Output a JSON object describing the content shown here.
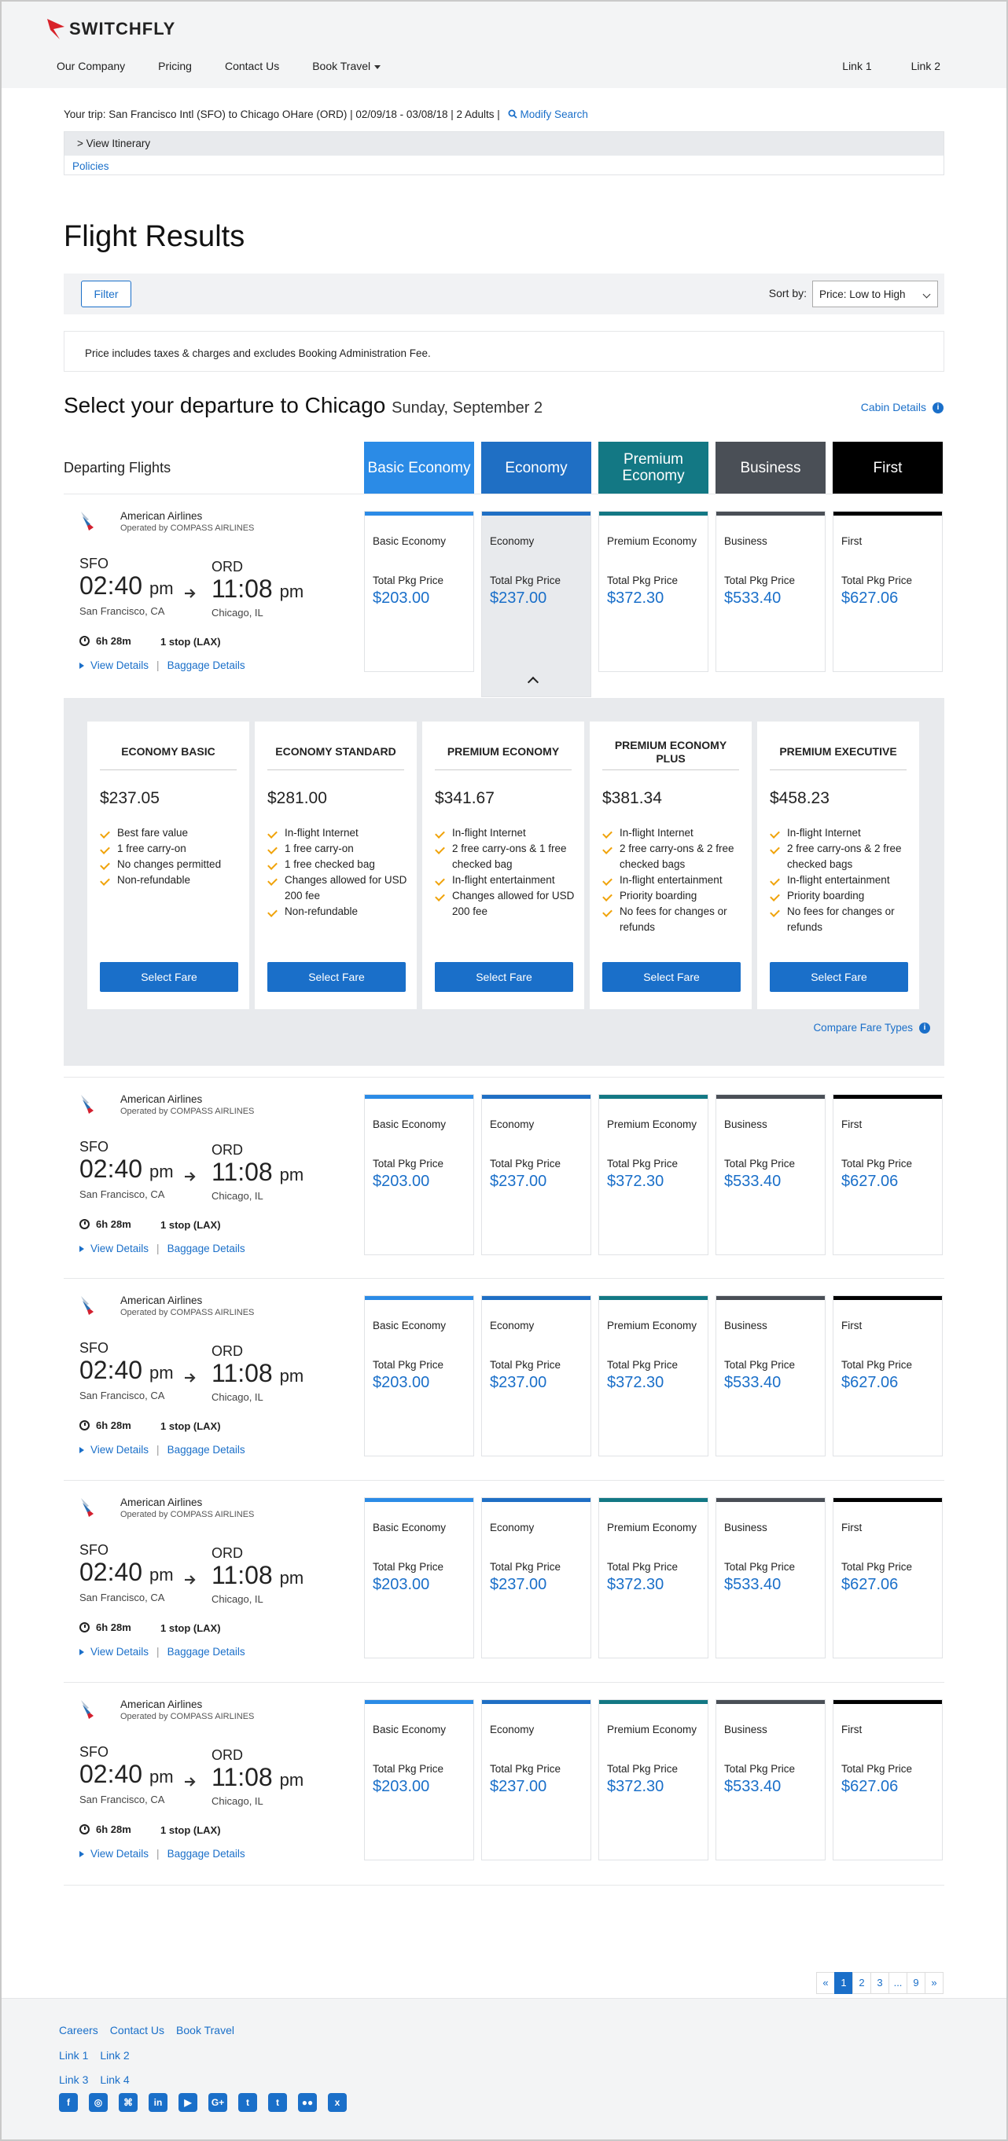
{
  "header": {
    "logo": "SWITCHFLY",
    "nav": [
      "Our Company",
      "Pricing",
      "Contact Us",
      "Book Travel"
    ],
    "nav_right": [
      "Link 1",
      "Link 2"
    ]
  },
  "trip": {
    "summary": "Your trip: San Francisco Intl (SFO) to Chicago OHare (ORD) | 02/09/18 - 03/08/18 | 2 Adults |",
    "modify": "Modify Search",
    "view_itinerary": "> View Itinerary",
    "policies": "Policies"
  },
  "page_title": "Flight Results",
  "filter": {
    "label": "Filter",
    "sort_label": "Sort by:",
    "sort_value": "Price: Low to High"
  },
  "notice": "Price includes taxes & charges and excludes Booking Administration Fee.",
  "departure": {
    "title": "Select your departure to Chicago",
    "date": "Sunday, September 2",
    "cabin_details": "Cabin Details",
    "departing_label": "Departing Flights"
  },
  "cabins": [
    {
      "header": "Basic Economy",
      "card": "Basic Economy",
      "color": "#2b8be6"
    },
    {
      "header": "Economy",
      "card": "Economy",
      "color": "#1f6fc4"
    },
    {
      "header": "Premium Economy",
      "card": "Premium Economy",
      "color": "#137884"
    },
    {
      "header": "Business",
      "card": "Business",
      "color": "#4a4f56"
    },
    {
      "header": "First",
      "card": "First",
      "color": "#000000"
    }
  ],
  "price_label": "Total Pkg Price",
  "flights": [
    {
      "airline": "American Airlines",
      "operated": "Operated by COMPASS AIRLINES",
      "from_code": "SFO",
      "dep_time": "02:40",
      "dep_ampm": "pm",
      "from_city": "San Francisco, CA",
      "to_code": "ORD",
      "arr_time": "11:08",
      "arr_ampm": "pm",
      "to_city": "Chicago, IL",
      "duration": "6h 28m",
      "stops": "1 stop (LAX)",
      "view_details": "View Details",
      "baggage": "Baggage Details",
      "prices": [
        "$203.00",
        "$237.00",
        "$372.30",
        "$533.40",
        "$627.06"
      ]
    },
    {
      "airline": "American Airlines",
      "operated": "Operated by COMPASS AIRLINES",
      "from_code": "SFO",
      "dep_time": "02:40",
      "dep_ampm": "pm",
      "from_city": "San Francisco, CA",
      "to_code": "ORD",
      "arr_time": "11:08",
      "arr_ampm": "pm",
      "to_city": "Chicago, IL",
      "duration": "6h 28m",
      "stops": "1 stop (LAX)",
      "view_details": "View Details",
      "baggage": "Baggage Details",
      "prices": [
        "$203.00",
        "$237.00",
        "$372.30",
        "$533.40",
        "$627.06"
      ]
    },
    {
      "airline": "American Airlines",
      "operated": "Operated by COMPASS AIRLINES",
      "from_code": "SFO",
      "dep_time": "02:40",
      "dep_ampm": "pm",
      "from_city": "San Francisco, CA",
      "to_code": "ORD",
      "arr_time": "11:08",
      "arr_ampm": "pm",
      "to_city": "Chicago, IL",
      "duration": "6h 28m",
      "stops": "1 stop (LAX)",
      "view_details": "View Details",
      "baggage": "Baggage Details",
      "prices": [
        "$203.00",
        "$237.00",
        "$372.30",
        "$533.40",
        "$627.06"
      ]
    },
    {
      "airline": "American Airlines",
      "operated": "Operated by COMPASS AIRLINES",
      "from_code": "SFO",
      "dep_time": "02:40",
      "dep_ampm": "pm",
      "from_city": "San Francisco, CA",
      "to_code": "ORD",
      "arr_time": "11:08",
      "arr_ampm": "pm",
      "to_city": "Chicago, IL",
      "duration": "6h 28m",
      "stops": "1 stop (LAX)",
      "view_details": "View Details",
      "baggage": "Baggage Details",
      "prices": [
        "$203.00",
        "$237.00",
        "$372.30",
        "$533.40",
        "$627.06"
      ]
    },
    {
      "airline": "American Airlines",
      "operated": "Operated by COMPASS AIRLINES",
      "from_code": "SFO",
      "dep_time": "02:40",
      "dep_ampm": "pm",
      "from_city": "San Francisco, CA",
      "to_code": "ORD",
      "arr_time": "11:08",
      "arr_ampm": "pm",
      "to_city": "Chicago, IL",
      "duration": "6h 28m",
      "stops": "1 stop (LAX)",
      "view_details": "View Details",
      "baggage": "Baggage Details",
      "prices": [
        "$203.00",
        "$237.00",
        "$372.30",
        "$533.40",
        "$627.06"
      ]
    }
  ],
  "selected_cabin": "Economy",
  "fares": [
    {
      "name": "ECONOMY BASIC",
      "price": "$237.05",
      "features": [
        "Best fare value",
        "1 free carry-on",
        "No changes permitted",
        "Non-refundable"
      ],
      "button": "Select Fare"
    },
    {
      "name": "ECONOMY STANDARD",
      "price": "$281.00",
      "features": [
        "In-flight Internet",
        "1 free carry-on",
        "1 free checked bag",
        "Changes allowed for USD 200 fee",
        "Non-refundable"
      ],
      "button": "Select Fare"
    },
    {
      "name": "PREMIUM ECONOMY",
      "price": "$341.67",
      "features": [
        "In-flight Internet",
        "2 free carry-ons & 1 free checked bag",
        "In-flight entertainment",
        "Changes allowed for USD 200 fee"
      ],
      "button": "Select Fare"
    },
    {
      "name": "PREMIUM ECONOMY PLUS",
      "price": "$381.34",
      "features": [
        "In-flight Internet",
        "2 free carry-ons & 2 free checked bags",
        "In-flight entertainment",
        "Priority boarding",
        "No fees for changes or refunds"
      ],
      "button": "Select Fare"
    },
    {
      "name": "PREMIUM EXECUTIVE",
      "price": "$458.23",
      "features": [
        "In-flight Internet",
        "2 free carry-ons & 2 free checked bags",
        "In-flight entertainment",
        "Priority boarding",
        "No fees for changes or refunds"
      ],
      "button": "Select Fare"
    }
  ],
  "compare": "Compare Fare Types",
  "pagination": [
    "«",
    "1",
    "2",
    "3",
    "...",
    "9",
    "»"
  ],
  "current_page": "1",
  "footer": {
    "row1": [
      "Careers",
      "Contact Us",
      "Book Travel"
    ],
    "row2": [
      "Link 1",
      "Link 2"
    ],
    "row3": [
      "Link 3",
      "Link 4"
    ],
    "social": [
      "facebook-icon",
      "instagram-icon",
      "github-icon",
      "linkedin-icon",
      "youtube-icon",
      "google-plus-icon",
      "twitter-icon",
      "tumblr-icon",
      "flickr-icon",
      "xing-icon"
    ],
    "social_glyphs": [
      "f",
      "◎",
      "⌘",
      "in",
      "▶",
      "G+",
      "t",
      "t",
      "●●",
      "x"
    ]
  }
}
